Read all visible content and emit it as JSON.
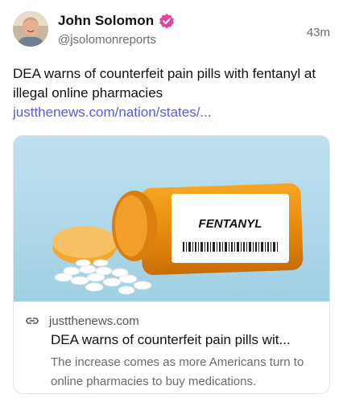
{
  "author": {
    "name": "John Solomon",
    "handle": "@jsolomonreports",
    "time": "43m",
    "verified_color": "#e0479e",
    "avatar_icon": "profile-photo"
  },
  "post": {
    "text": "DEA warns of counterfeit pain pills with fentanyl at illegal online pharmacies",
    "link": "justthenews.com/nation/states/...",
    "link_color": "#5b5bd6"
  },
  "card": {
    "image_label": "FENTANYL",
    "domain": "justthenews.com",
    "title": "DEA warns of counterfeit pain pills wit...",
    "description": "The increase comes as more Americans turn to online pharmacies to buy medications.",
    "domain_icon": "link-icon"
  }
}
